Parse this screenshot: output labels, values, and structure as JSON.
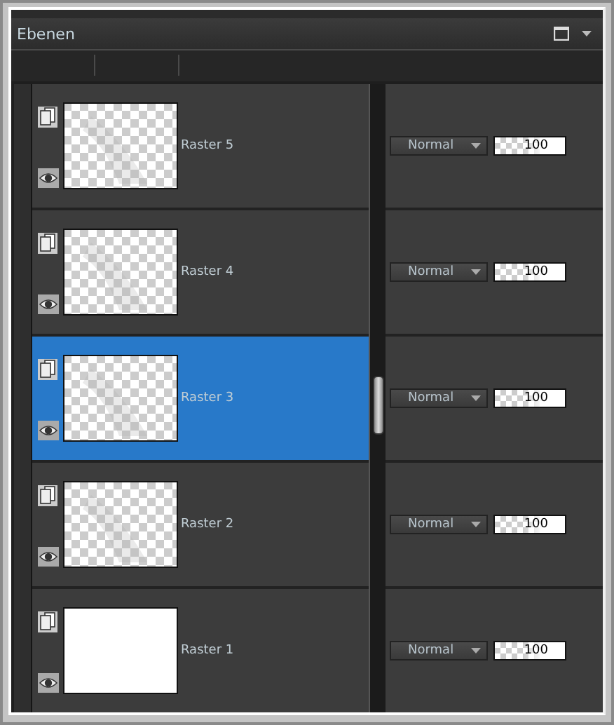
{
  "panel": {
    "title": "Ebenen"
  },
  "layers": [
    {
      "name": "Raster 5",
      "selected": false,
      "kind": "transparent",
      "blend_mode": "Normal",
      "opacity": "100"
    },
    {
      "name": "Raster 4",
      "selected": false,
      "kind": "transparent",
      "blend_mode": "Normal",
      "opacity": "100"
    },
    {
      "name": "Raster 3",
      "selected": true,
      "kind": "transparent",
      "blend_mode": "Normal",
      "opacity": "100"
    },
    {
      "name": "Raster 2",
      "selected": false,
      "kind": "transparent",
      "blend_mode": "Normal",
      "opacity": "100"
    },
    {
      "name": "Raster 1",
      "selected": false,
      "kind": "white",
      "blend_mode": "Normal",
      "opacity": "100"
    }
  ]
}
